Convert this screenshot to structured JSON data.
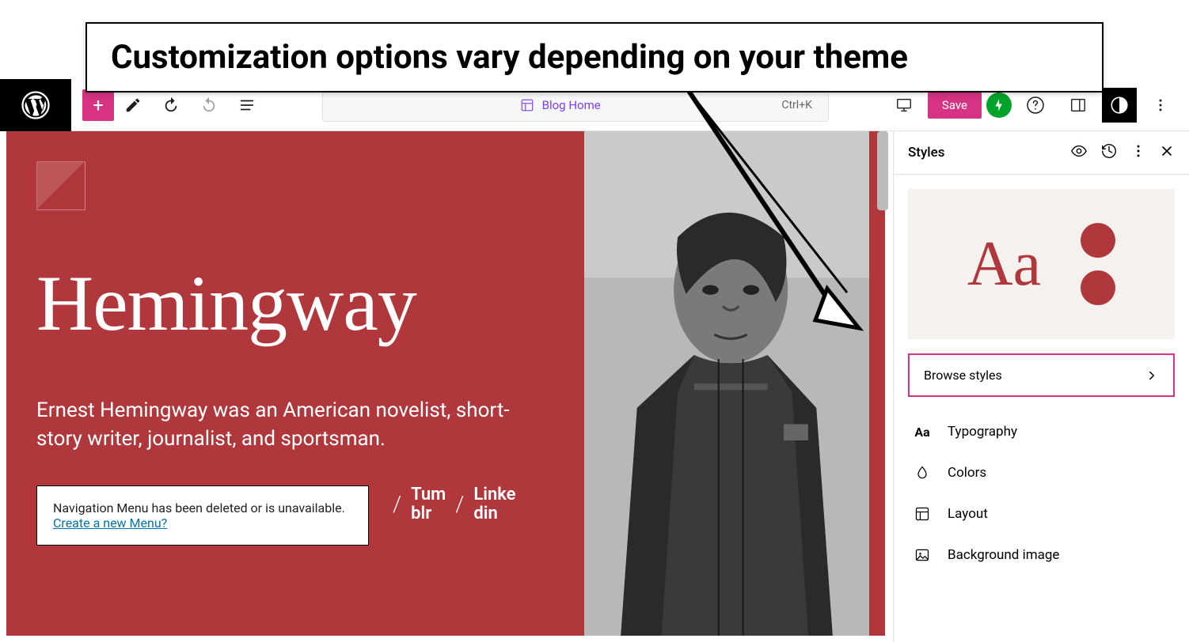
{
  "annotation": {
    "callout": "Customization options vary depending on your theme"
  },
  "toolbar": {
    "breadcrumb_label": "Blog Home",
    "shortcut": "Ctrl+K",
    "save_label": "Save"
  },
  "canvas": {
    "site_title": "Hemingway",
    "tagline": "Ernest Hemingway was an American novelist, short-story writer, journalist, and sportsman.",
    "nav_warning_text": "Navigation Menu has been deleted or is unavailable. ",
    "nav_warning_link": "Create a new Menu?",
    "footer_links": [
      {
        "line1": "Tum",
        "line2": "blr"
      },
      {
        "line1": "Linke",
        "line2": "din"
      }
    ]
  },
  "sidebar": {
    "title": "Styles",
    "preview_text": "Aa",
    "browse_styles_label": "Browse styles",
    "options": [
      {
        "icon": "typography",
        "label": "Typography"
      },
      {
        "icon": "colors",
        "label": "Colors"
      },
      {
        "icon": "layout",
        "label": "Layout"
      },
      {
        "icon": "background",
        "label": "Background image"
      }
    ]
  },
  "colors": {
    "accent": "#d63384",
    "theme_red": "#b0373b"
  }
}
